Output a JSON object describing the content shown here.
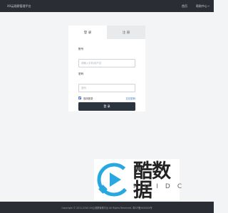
{
  "header": {
    "brand": "XX云观察管理平台",
    "nav": [
      {
        "label": "首页"
      },
      {
        "label": "帮助中心"
      }
    ]
  },
  "login": {
    "tabs": [
      {
        "label": "登 录",
        "active": true
      },
      {
        "label": "注 册",
        "active": false
      }
    ],
    "account": {
      "label": "账号",
      "placeholder": "请输入手机/用户名",
      "value": ""
    },
    "password": {
      "label": "密码",
      "placeholder": "密码",
      "value": ""
    },
    "remember": {
      "label": "保持登录",
      "checked": true
    },
    "forgot_label": "忘记密码",
    "submit_label": "登 录"
  },
  "watermark": {
    "title": "酷数据",
    "subtitle": "KUIDC",
    "icon": "play-logo-icon"
  },
  "footer": {
    "text": "Copyright © 2011-2020 XX云观察管理平台 All Rights Reserved. 粤ICP备XXXXXX号"
  },
  "colors": {
    "topbar": "#2a2d33",
    "page_bg": "#f3f4f6",
    "button": "#2c3440",
    "link": "#2f6bbf",
    "inactive_tab": "#e9eaec",
    "logo_blue": "#27a8e0"
  }
}
